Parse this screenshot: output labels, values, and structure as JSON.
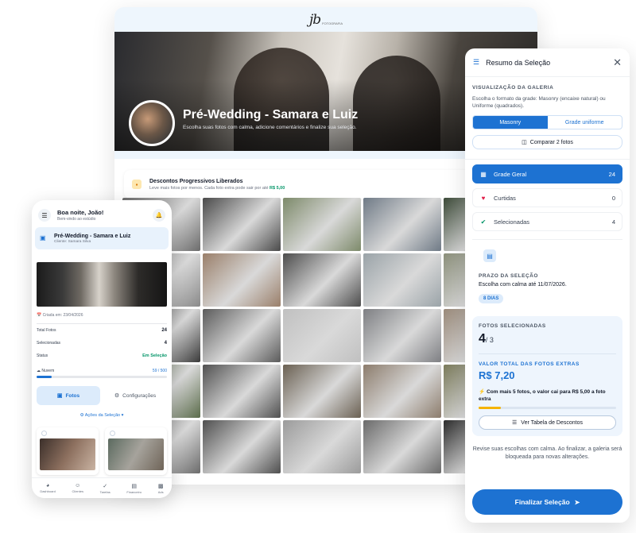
{
  "gallery": {
    "logo": "jb",
    "logo_sub": "FOTOGRAFIA",
    "title": "Pré-Wedding - Samara e Luiz",
    "subtitle": "Escolha suas fotos com calma, adicione comentários e finalize sua seleção.",
    "discount": {
      "title": "Descontos Progressivos Liberados",
      "subtitle": "Leve mais fotos por menos. Cada foto extra pode sair por até",
      "price": "R$ 5,00"
    },
    "photos": [
      "#6b6b6b",
      "#4a4a4a",
      "#7d8a6a",
      "#6f7a86",
      "#3c4a38",
      "#8a8a8a",
      "#9a7f6a",
      "#4d4d4d",
      "#9aa3a8",
      "#8b8f7a",
      "#3a3a3a",
      "#5b5b5b",
      "#c0c0c0",
      "#7e7f83",
      "#9a8a7a",
      "#5a6b4a",
      "#505050",
      "#6a6052",
      "#8c7c6c",
      "#7a7a5a",
      "#6b6b6b",
      "#4f4f4f",
      "#9b9b9b",
      "#6a6a6a",
      "#2b2b2b"
    ]
  },
  "mobile": {
    "greeting": "Boa noite, João!",
    "greeting_sub": "Bem-vindo ao estúdio",
    "card_title": "Pré-Wedding - Samara e Luiz",
    "card_client": "Cliente: Samara Silva",
    "created": "Criada em: 23/04/2026",
    "stats": [
      {
        "label": "Total Fotos",
        "value": "24"
      },
      {
        "label": "Selecionadas",
        "value": "4"
      },
      {
        "label": "Status",
        "value": "Em Seleção"
      }
    ],
    "storage_label": "Nuvem",
    "storage_value": "59 / 500",
    "storage_fraction": 0.118,
    "tab_photos": "Fotos",
    "tab_settings": "Configurações",
    "actions": "Ações da Seleção",
    "nav": [
      "Dashboard",
      "Clientes",
      "Tarefas",
      "Financeiro",
      "Ads"
    ]
  },
  "panel": {
    "title": "Resumo da Seleção",
    "view_caption": "VISUALIZAÇÃO DA GALERIA",
    "view_desc": "Escolha o formato da grade: Masonry (encaixe natural) ou Uniforme (quadrados).",
    "seg_masonry": "Masonry",
    "seg_uniform": "Grade uniforme",
    "compare": "Comparar 2 fotos",
    "filters": [
      {
        "label": "Grade Geral",
        "count": "24"
      },
      {
        "label": "Curtidas",
        "count": "0"
      },
      {
        "label": "Selecionadas",
        "count": "4"
      }
    ],
    "deadline_caption": "PRAZO DA SELEÇÃO",
    "deadline_text": "Escolha com calma até 11/07/2026.",
    "deadline_badge": "8 DIAS",
    "selected_caption": "FOTOS SELECIONADAS",
    "selected_count": "4",
    "selected_total": "/ 3",
    "total_caption": "VALOR TOTAL DAS FOTOS EXTRAS",
    "total_value": "R$ 7,20",
    "hint": "Com mais 5 fotos, o valor cai para R$ 5,00 a foto extra",
    "hint_progress": 0.16,
    "table_button": "Ver Tabela de Descontos",
    "footer": "Revise suas escolhas com calma. Ao finalizar, a galeria será bloqueada para novas alterações.",
    "finish_button": "Finalizar Seleção"
  }
}
